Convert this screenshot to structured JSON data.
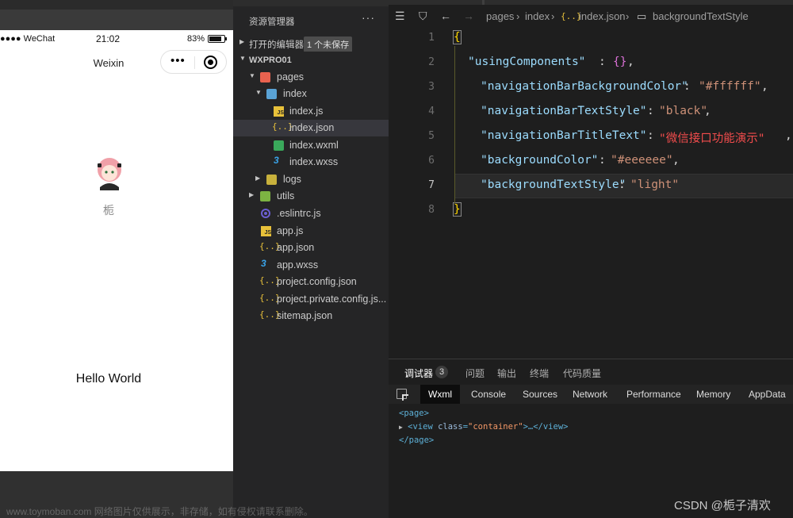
{
  "simulator": {
    "status": {
      "carrier": "●●●● WeChat",
      "time": "21:02",
      "battery": "83%"
    },
    "navbar_title": "Weixin",
    "capsule_dots": "•••",
    "nickname": "栀",
    "hello": "Hello World"
  },
  "explorer": {
    "title": "资源管理器",
    "more": "···",
    "open_editors": "打开的编辑器",
    "unsaved_badge": "1 个未保存",
    "project": "WXPRO01",
    "tree": [
      {
        "label": "pages"
      },
      {
        "label": "index"
      },
      {
        "label": "index.js"
      },
      {
        "label": "index.json"
      },
      {
        "label": "index.wxml"
      },
      {
        "label": "index.wxss"
      },
      {
        "label": "logs"
      },
      {
        "label": "utils"
      },
      {
        "label": ".eslintrc.js"
      },
      {
        "label": "app.js"
      },
      {
        "label": "app.json"
      },
      {
        "label": "app.wxss"
      },
      {
        "label": "project.config.json"
      },
      {
        "label": "project.private.config.js..."
      },
      {
        "label": "sitemap.json"
      }
    ]
  },
  "breadcrumb": [
    "pages",
    "index",
    "index.json",
    "backgroundTextStyle"
  ],
  "code": {
    "line_numbers": [
      "1",
      "2",
      "3",
      "4",
      "5",
      "6",
      "7",
      "8"
    ],
    "lines": [
      {
        "key": "",
        "value": ""
      },
      {
        "key": "\"usingComponents\"",
        "value": "{}"
      },
      {
        "key": "\"navigationBarBackgroundColor\"",
        "value": "\"#ffffff\""
      },
      {
        "key": "\"navigationBarTextStyle\"",
        "value": "\"black\""
      },
      {
        "key": "\"navigationBarTitleText\"",
        "value": "\"微信接口功能演示\""
      },
      {
        "key": "\"backgroundColor\"",
        "value": "\"#eeeeee\""
      },
      {
        "key": "\"backgroundTextStyle\"",
        "value": "\"light\""
      }
    ]
  },
  "debug": {
    "tabs": [
      "调试器",
      "问题",
      "输出",
      "终端",
      "代码质量"
    ],
    "debugger_count": "3",
    "tools": [
      "Wxml",
      "Console",
      "Sources",
      "Network",
      "Performance",
      "Memory",
      "AppData"
    ],
    "dom": {
      "open": "<page>",
      "view_open": "<view",
      "attr": "class",
      "val": "\"container\"",
      "view_rest": ">…</view>",
      "close": "</page>"
    }
  },
  "watermarks": {
    "left": "www.toymoban.com 网络图片仅供展示，非存储，如有侵权请联系删除。",
    "right": "CSDN @栀子清欢"
  },
  "colors": {
    "editor_bg": "#1e1e1e",
    "json_key": "#9cdcfe",
    "json_string": "#ce9178",
    "selected_row": "#37373d"
  }
}
